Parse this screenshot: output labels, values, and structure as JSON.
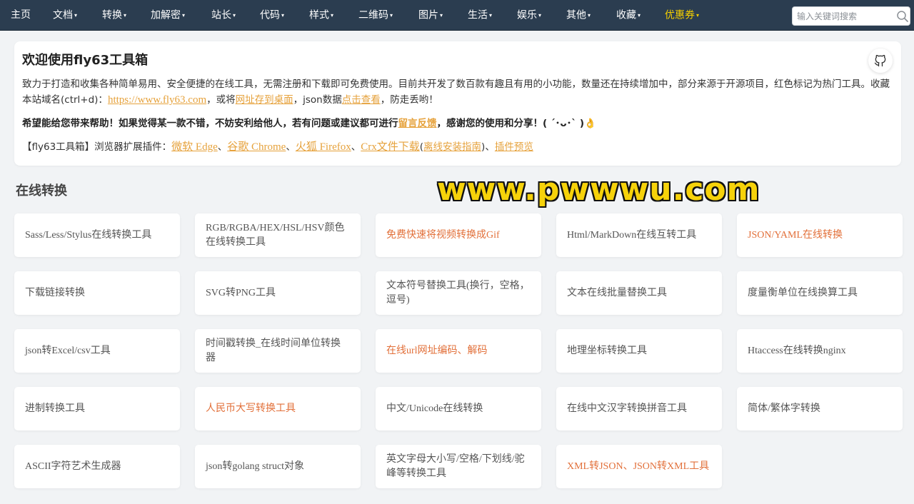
{
  "nav": {
    "items": [
      {
        "label": "主页",
        "caret": false,
        "highlight": false
      },
      {
        "label": "文档",
        "caret": true,
        "highlight": false
      },
      {
        "label": "转换",
        "caret": true,
        "highlight": false
      },
      {
        "label": "加解密",
        "caret": true,
        "highlight": false
      },
      {
        "label": "站长",
        "caret": true,
        "highlight": false
      },
      {
        "label": "代码",
        "caret": true,
        "highlight": false
      },
      {
        "label": "样式",
        "caret": true,
        "highlight": false
      },
      {
        "label": "二维码",
        "caret": true,
        "highlight": false
      },
      {
        "label": "图片",
        "caret": true,
        "highlight": false
      },
      {
        "label": "生活",
        "caret": true,
        "highlight": false
      },
      {
        "label": "娱乐",
        "caret": true,
        "highlight": false
      },
      {
        "label": "其他",
        "caret": true,
        "highlight": false
      },
      {
        "label": "收藏",
        "caret": true,
        "highlight": false
      },
      {
        "label": "优惠券",
        "caret": true,
        "highlight": true
      }
    ],
    "caret_glyph": "▾",
    "search_placeholder": "输入关键词搜索",
    "search_icon": "search-icon"
  },
  "intro": {
    "title": "欢迎使用fly63工具箱",
    "github_icon": "github-icon",
    "p1_a": "致力于打造和收集各种简单易用、安全便捷的在线工具，无需注册和下载即可免费使用。目前共开发了数百款有趣且有用的小功能，数量还在持续增加中，部分来源于开源项目，红色标记为热门工具。收藏本站域名(ctrl+d)：",
    "p1_url": "https://www.fly63.com",
    "p1_b": "，或将",
    "p1_link_desktop": "网址存到桌面",
    "p1_c": "，json数据",
    "p1_link_view": "点击查看",
    "p1_d": "，防走丢哟！",
    "p2_a": "希望能给您带来帮助！如果觉得某一款不错，不妨安利给他人，若有问题或建议都可进行",
    "p2_link": "留言反馈",
    "p2_b": "，感谢您的使用和分享！( ´･ᴗ･` )",
    "p2_emoji": "👌",
    "p3_prefix": "【fly63工具箱】浏览器扩展插件：",
    "p3_links": [
      "微软 Edge",
      "谷歌 Chrome",
      "火狐 Firefox",
      "Crx文件下载",
      "离线安装指南",
      "插件预览"
    ],
    "sep": "、",
    "paren_open": "(",
    "paren_close": ")"
  },
  "section": {
    "title": "在线转换"
  },
  "watermark": "www.pwwwu.com",
  "colors": {
    "navbar": "#2b3d50",
    "link": "#e6a23c",
    "hot": "#e2703a",
    "coupon": "#f5d000"
  },
  "tools": [
    {
      "label": "Sass/Less/Stylus在线转换工具",
      "hot": false
    },
    {
      "label": "RGB/RGBA/HEX/HSL/HSV颜色在线转换工具",
      "hot": false
    },
    {
      "label": "免费快速将视频转换成Gif",
      "hot": true
    },
    {
      "label": "Html/MarkDown在线互转工具",
      "hot": false
    },
    {
      "label": "JSON/YAML在线转换",
      "hot": true
    },
    {
      "label": "下载链接转换",
      "hot": false
    },
    {
      "label": "SVG转PNG工具",
      "hot": false
    },
    {
      "label": "文本符号替换工具(换行，空格，逗号)",
      "hot": false
    },
    {
      "label": "文本在线批量替换工具",
      "hot": false
    },
    {
      "label": "度量衡单位在线换算工具",
      "hot": false
    },
    {
      "label": "json转Excel/csv工具",
      "hot": false
    },
    {
      "label": "时间戳转换_在线时间单位转换器",
      "hot": false
    },
    {
      "label": "在线url网址编码、解码",
      "hot": true
    },
    {
      "label": "地理坐标转换工具",
      "hot": false
    },
    {
      "label": "Htaccess在线转换nginx",
      "hot": false
    },
    {
      "label": "进制转换工具",
      "hot": false
    },
    {
      "label": "人民币大写转换工具",
      "hot": true
    },
    {
      "label": "中文/Unicode在线转换",
      "hot": false
    },
    {
      "label": "在线中文汉字转换拼音工具",
      "hot": false
    },
    {
      "label": "简体/繁体字转换",
      "hot": false
    },
    {
      "label": "ASCII字符艺术生成器",
      "hot": false
    },
    {
      "label": "json转golang struct对象",
      "hot": false
    },
    {
      "label": "英文字母大小写/空格/下划线/驼峰等转换工具",
      "hot": false
    },
    {
      "label": "XML转JSON、JSON转XML工具",
      "hot": true
    }
  ]
}
